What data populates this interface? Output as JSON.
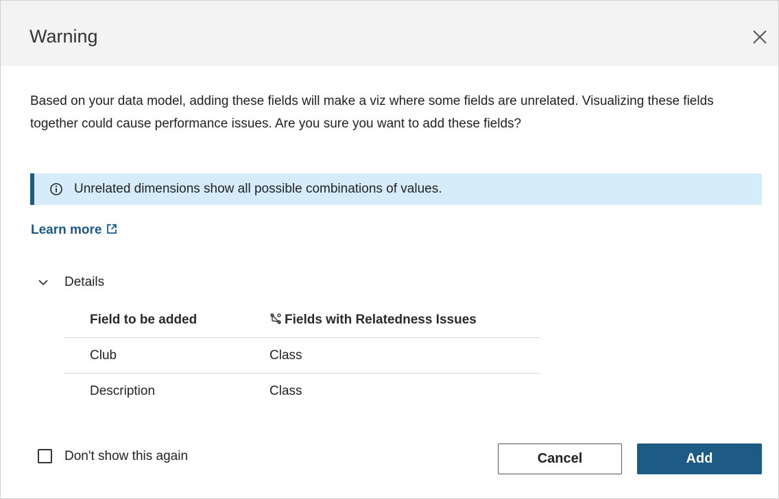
{
  "dialog": {
    "title": "Warning",
    "message": "Based on your data model, adding these fields will make a viz where some fields are unrelated. Visualizing these fields together could cause performance issues. Are you sure you want to add these fields?",
    "info_banner": "Unrelated dimensions show all possible combinations of values.",
    "learn_more": "Learn more",
    "details_label": "Details",
    "details_expanded": true,
    "table": {
      "headers": [
        "Field to be added",
        "Fields with Relatedness Issues"
      ],
      "rows": [
        [
          "Club",
          "Class"
        ],
        [
          "Description",
          "Class"
        ]
      ]
    },
    "checkbox_label": "Don't show this again",
    "checkbox_checked": false,
    "cancel_label": "Cancel",
    "add_label": "Add"
  },
  "icons": {
    "close": "close-icon",
    "info": "info-icon",
    "external": "external-link-icon",
    "chevron": "chevron-down-icon",
    "unrelated": "unrelated-fields-icon"
  },
  "colors": {
    "header_bg": "#f3f3f3",
    "banner_bg": "#d6ecfb",
    "accent": "#1d5a84",
    "link": "#1a5a8a"
  }
}
